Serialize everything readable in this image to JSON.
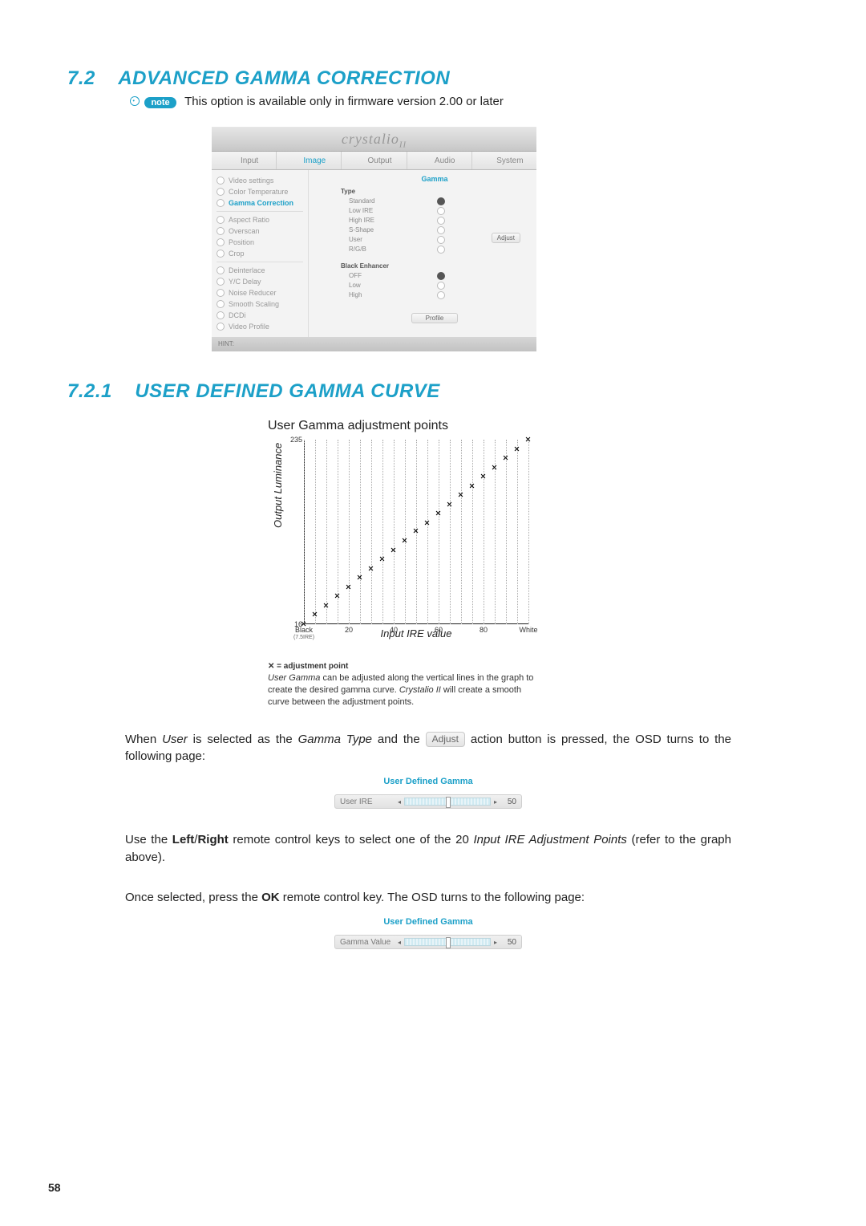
{
  "page_number": "58",
  "section": {
    "num": "7.2",
    "title": "ADVANCED GAMMA CORRECTION"
  },
  "note": {
    "pill": "note",
    "text": "This option is available only in firmware version 2.00 or later"
  },
  "osd": {
    "brand": "crystalio",
    "brand_sub": "II",
    "tabs": [
      "Input",
      "Image",
      "Output",
      "Audio",
      "System"
    ],
    "tab_active": 1,
    "side_groups": [
      [
        "Video settings",
        "Color Temperature",
        "Gamma Correction"
      ],
      [
        "Aspect Ratio",
        "Overscan",
        "Position",
        "Crop"
      ],
      [
        "Deinterlace",
        "Y/C Delay",
        "Noise Reducer",
        "Smooth Scaling",
        "DCDi",
        "Video Profile"
      ]
    ],
    "side_selected": "Gamma Correction",
    "pane_title": "Gamma",
    "type_label": "Type",
    "type_opts": [
      "Standard",
      "Low IRE",
      "High IRE",
      "S-Shape",
      "User",
      "R/G/B"
    ],
    "type_selected": 0,
    "black_label": "Black Enhancer",
    "black_opts": [
      "OFF",
      "Low",
      "High"
    ],
    "black_selected": 0,
    "adjust_btn": "Adjust",
    "profile_btn": "Profile",
    "hint": "HINT:"
  },
  "subsection": {
    "num": "7.2.1",
    "title": "USER DEFINED GAMMA CURVE"
  },
  "chart_data": {
    "type": "scatter",
    "title": "User Gamma adjustment points",
    "xlabel": "Input IRE value",
    "ylabel": "Output Luminance",
    "ylim": [
      16,
      235
    ],
    "xticks": [
      "Black",
      "20",
      "40",
      "60",
      "80",
      "White"
    ],
    "xtick_sub": "(7.5IRE)",
    "yticks": [
      "16",
      "235"
    ],
    "x": [
      0,
      5,
      10,
      15,
      20,
      25,
      30,
      35,
      40,
      45,
      50,
      55,
      60,
      65,
      70,
      75,
      80,
      85,
      90,
      95,
      100
    ],
    "y": [
      16,
      27,
      38,
      49,
      60,
      71,
      82,
      93,
      104,
      115,
      126,
      136,
      147,
      158,
      169,
      180,
      191,
      202,
      213,
      224,
      235
    ],
    "gridlines_x": [
      0,
      5,
      10,
      15,
      20,
      25,
      30,
      35,
      40,
      45,
      50,
      55,
      60,
      65,
      70,
      75,
      80,
      85,
      90,
      95,
      100
    ],
    "legend_mark": "✕ = adjustment point",
    "legend_body": "User Gamma can be adjusted along the vertical lines in the graph to create the desired gamma curve. Crystalio II will create a smooth curve between the adjustment points.",
    "legend_em1": "User Gamma",
    "legend_em2": "Crystalio II"
  },
  "p1a": "When ",
  "p1_em1": "User",
  "p1b": " is selected as the ",
  "p1_em2": "Gamma Type",
  "p1c": " and the ",
  "p1_btn": "Adjust",
  "p1d": " action button is pressed, the OSD turns to the following page:",
  "slider1": {
    "heading": "User Defined Gamma",
    "label": "User IRE",
    "value": "50"
  },
  "p2a": "Use the ",
  "p2_b1": "Left",
  "p2_slash": "/",
  "p2_b2": "Right",
  "p2b": " remote control keys to select one of the 20 ",
  "p2_em": "Input IRE Adjustment Points",
  "p2c": " (refer to the graph above).",
  "p3a": "Once selected, press the ",
  "p3_b": "OK",
  "p3b": " remote control key. The OSD turns to the following page:",
  "slider2": {
    "heading": "User Defined Gamma",
    "label": "Gamma Value",
    "value": "50"
  }
}
